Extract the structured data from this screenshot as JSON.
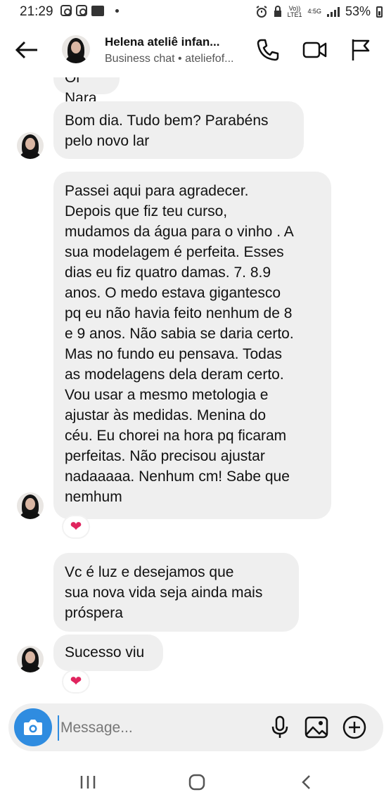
{
  "status_bar": {
    "time": "21:29",
    "network_top": "Vo))",
    "network_bottom": "LTE1",
    "network_type": "4:5G",
    "battery": "53%"
  },
  "header": {
    "contact_name": "Helena ateliê  infan...",
    "subtitle": "Business chat • ateliefof..."
  },
  "messages": [
    {
      "text": "Oi Nara"
    },
    {
      "text": "Bom dia. Tudo bem? Parabéns\npelo novo lar"
    },
    {
      "text": "Passei aqui para agradecer.\nDepois que fiz teu curso,\nmudamos da água para o vinho . A\nsua modelagem é perfeita. Esses\ndias eu fiz quatro damas. 7. 8.9\nanos. O medo estava  gigantesco\npq eu não havia feito nenhum de 8\ne 9 anos. Não sabia se daria certo.\nMas no fundo eu pensava. Todas\nas modelagens dela deram certo.\nVou usar a mesmo metologia e\najustar às medidas. Menina do\ncéu. Eu chorei na hora pq ficaram\nperfeitas. Não precisou ajustar\nnadaaaaa. Nenhum cm! Sabe que\nnemhum"
    },
    {
      "text": "Vc é luz e desejamos  que\nsua nova vida seja ainda mais\npróspera"
    },
    {
      "text": "Sucesso viu"
    }
  ],
  "reactions": [
    "❤",
    "❤"
  ],
  "composer": {
    "placeholder": "Message..."
  },
  "colors": {
    "bubble": "#efefef",
    "camera_button": "#2f8ce0",
    "heart": "#e0245e"
  }
}
